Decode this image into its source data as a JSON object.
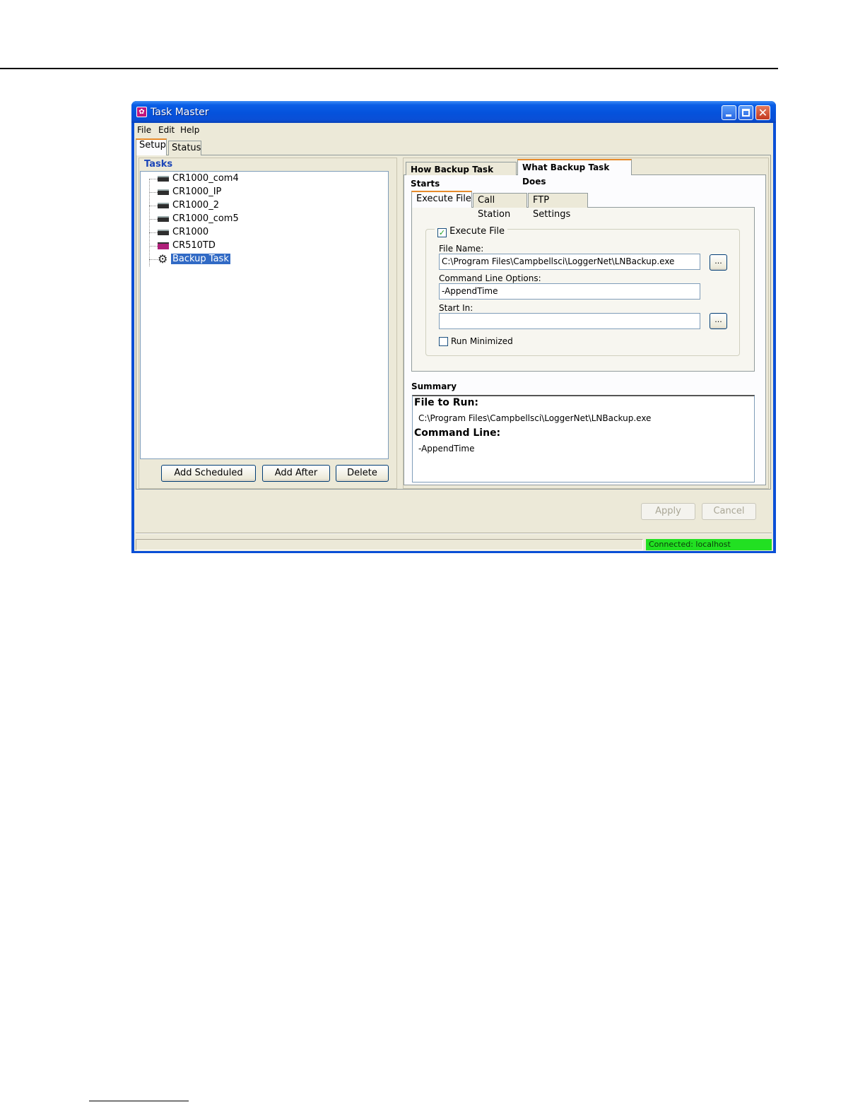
{
  "window": {
    "title": "Task Master",
    "buttons": {
      "minimize": "minimize-icon",
      "maximize": "maximize-icon",
      "close": "close-icon"
    }
  },
  "menu": {
    "items": [
      "File",
      "Edit",
      "Help"
    ]
  },
  "top_tabs": [
    {
      "label": "Setup",
      "active": true
    },
    {
      "label": "Status",
      "active": false
    }
  ],
  "tasks": {
    "title": "Tasks",
    "items": [
      {
        "label": "CR1000_com4",
        "icon": "datalogger-icon"
      },
      {
        "label": "CR1000_IP",
        "icon": "datalogger-icon"
      },
      {
        "label": "CR1000_2",
        "icon": "datalogger-icon"
      },
      {
        "label": "CR1000_com5",
        "icon": "datalogger-icon"
      },
      {
        "label": "CR1000",
        "icon": "datalogger-icon"
      },
      {
        "label": "CR510TD",
        "icon": "datalogger-icon"
      },
      {
        "label": "Backup Task",
        "icon": "gear-icon",
        "selected": true
      }
    ],
    "buttons": {
      "add_scheduled": "Add Scheduled",
      "add_after": "Add After",
      "delete": "Delete"
    }
  },
  "task_tabs": [
    {
      "label": "How Backup Task Starts",
      "active": false
    },
    {
      "label": "What Backup Task Does",
      "active": true
    }
  ],
  "sub_tabs": [
    {
      "label": "Execute File",
      "active": true
    },
    {
      "label": "Call Station",
      "active": false
    },
    {
      "label": "FTP Settings",
      "active": false
    }
  ],
  "execute": {
    "group_label": "Execute File",
    "enabled": true,
    "file_name_label": "File Name:",
    "file_name": "C:\\Program Files\\Campbellsci\\LoggerNet\\LNBackup.exe",
    "browse_label": "...",
    "cmd_label": "Command Line Options:",
    "cmd_value": "-AppendTime",
    "start_in_label": "Start In:",
    "start_in_value": "",
    "run_minimized_label": "Run Minimized",
    "run_minimized": false
  },
  "summary": {
    "label": "Summary",
    "file_heading": "File to Run:",
    "file_value": "C:\\Program Files\\Campbellsci\\LoggerNet\\LNBackup.exe",
    "cmd_heading": "Command Line:",
    "cmd_value": "-AppendTime"
  },
  "footer_buttons": {
    "apply": "Apply",
    "cancel": "Cancel"
  },
  "status": {
    "connection": "Connected: localhost",
    "color": "#22e022"
  }
}
